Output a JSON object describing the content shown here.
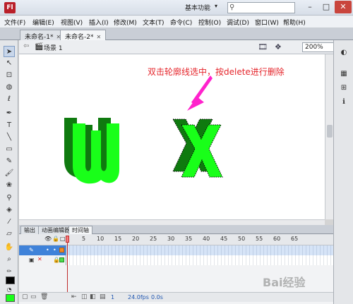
{
  "app": {
    "logo": "Fl",
    "workspace": "基本功能",
    "accent": "#b9202a"
  },
  "menu": [
    "文件(F)",
    "编辑(E)",
    "视图(V)",
    "插入(I)",
    "修改(M)",
    "文本(T)",
    "命令(C)",
    "控制(O)",
    "调试(D)",
    "窗口(W)",
    "帮助(H)"
  ],
  "doc_tabs": [
    {
      "label": "未命名-1*",
      "active": false
    },
    {
      "label": "未命名-2*",
      "active": true
    }
  ],
  "scene": {
    "label": "场景 1",
    "zoom": "200%"
  },
  "stage": {
    "annotation": "双击轮廓线选中，按delete进行删除",
    "annotation_color": "#e5252b",
    "shape_fill": "#19ff19",
    "shape_extrude": "#0f7a0f"
  },
  "panel_tabs": [
    {
      "label": "输出",
      "active": false
    },
    {
      "label": "动画编辑器",
      "active": false
    },
    {
      "label": "时间轴",
      "active": true
    }
  ],
  "timeline": {
    "ticks": [
      "5",
      "10",
      "15",
      "20",
      "25",
      "30",
      "35",
      "40",
      "45",
      "50",
      "55",
      "60",
      "65"
    ],
    "status": {
      "frame": "1",
      "fps": "24.0fps",
      "time": "0.0s"
    }
  },
  "colors": {
    "stroke": "#000000",
    "fill": "#19ff19"
  },
  "watermark": "Bai经验"
}
